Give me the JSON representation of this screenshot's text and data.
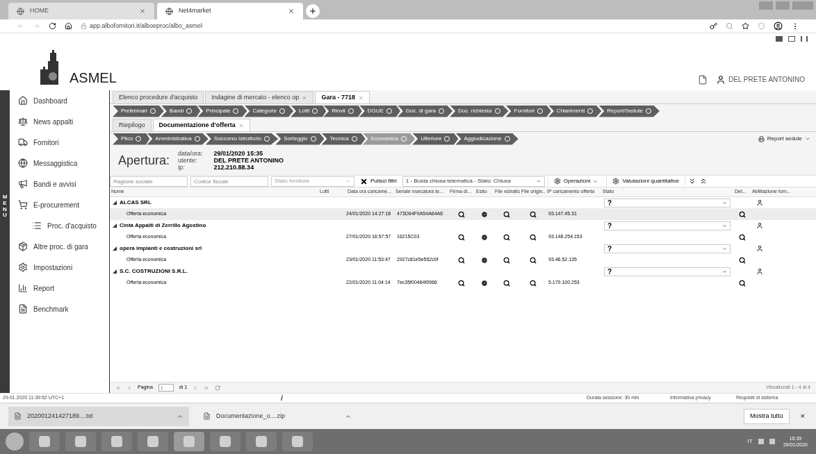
{
  "browser": {
    "tabs": [
      {
        "label": "HOME",
        "selected": false
      },
      {
        "label": "Net4market",
        "selected": true
      }
    ],
    "url": "app.albofornitori.it/alboeproc/albo_asmel"
  },
  "header": {
    "logo": "ASMEL",
    "user": "DEL PRETE ANTONINO"
  },
  "menu_strip": "MENU",
  "sidebar": {
    "items": [
      {
        "label": "Dashboard"
      },
      {
        "label": "News appalti"
      },
      {
        "label": "Fornitori"
      },
      {
        "label": "Messaggistica"
      },
      {
        "label": "Bandi e avvisi"
      },
      {
        "label": "E-procurement",
        "children": [
          {
            "label": "Proc. d'acquisto"
          }
        ]
      },
      {
        "label": "Altre proc. di gara"
      },
      {
        "label": "Impostazioni"
      },
      {
        "label": "Report"
      },
      {
        "label": "Benchmark"
      }
    ]
  },
  "tabs": [
    {
      "label": "Elenco procedure d'acquisto",
      "closable": false,
      "selected": false
    },
    {
      "label": "Indagine di mercato - elenco op",
      "closable": true,
      "selected": false
    },
    {
      "label": "Gara - 7718",
      "closable": true,
      "selected": true
    }
  ],
  "steps_main": [
    {
      "label": "Preliminari"
    },
    {
      "label": "Bandi"
    },
    {
      "label": "Principale"
    },
    {
      "label": "Categorie"
    },
    {
      "label": "Lotti"
    },
    {
      "label": "Rinvii"
    },
    {
      "label": "DGUE"
    },
    {
      "label": "Doc. di gara"
    },
    {
      "label": "Doc. richiesta"
    },
    {
      "label": "Fornitori"
    },
    {
      "label": "Chiarimenti"
    },
    {
      "label": "Report/Sedute"
    }
  ],
  "subtabs": [
    {
      "label": "Riepilogo",
      "closable": false,
      "selected": false
    },
    {
      "label": "Documentazione d'offerta",
      "closable": true,
      "selected": true
    }
  ],
  "steps_offer": [
    {
      "label": "Plico",
      "selected": false
    },
    {
      "label": "Amministrativa",
      "selected": false
    },
    {
      "label": "Soccorso istruttorio",
      "selected": false
    },
    {
      "label": "Sorteggio",
      "selected": false
    },
    {
      "label": "Tecnica",
      "selected": false
    },
    {
      "label": "Economica",
      "selected": true
    },
    {
      "label": "Ulteriore",
      "selected": false
    },
    {
      "label": "Aggiudicazione",
      "selected": false
    }
  ],
  "report_button": "Report sedute",
  "opening": {
    "title": "Apertura:",
    "fields": [
      {
        "label": "data/ora:",
        "value": "29/01/2020 15:35"
      },
      {
        "label": "utente:",
        "value": "DEL PRETE ANTONINO"
      },
      {
        "label": "ip:",
        "value": "212.210.88.34"
      }
    ]
  },
  "filters": {
    "ragione_placeholder": "Ragione sociale",
    "codice_placeholder": "Codice fiscale",
    "stato_placeholder": "Stato fornitore",
    "clear": "Pulisci filtri",
    "busta": "1 - Busta chiusa telematica - Stato: Chiusa",
    "operations": "Operazioni",
    "valuations": "Valutazioni quantitative"
  },
  "table": {
    "columns": [
      "Nome",
      "Lotti",
      "Data ora caricame...",
      "Seriale marcatura te...",
      "Firma di...",
      "Esito",
      "File estratto",
      "File origin...",
      "IP caricamento offerta",
      "Stato",
      "Det...",
      "Abilitazione forn..."
    ],
    "groups": [
      {
        "name": "ALCAS SRL",
        "expanded": true,
        "stato": "?",
        "offers": [
          {
            "nome": "Offerta economica",
            "data": "24/01/2020 14:27:18",
            "seriale": "473D64F9A54A64AE",
            "ip": "93.147.45.31",
            "selected": true
          }
        ]
      },
      {
        "name": "Cinta Appalti di Zerrillo Agostino",
        "expanded": true,
        "stato": "?",
        "offers": [
          {
            "nome": "Offerta economica",
            "data": "27/01/2020 16:57:57",
            "seriale": "16215C03",
            "ip": "93.148.254.153",
            "selected": false
          }
        ]
      },
      {
        "name": "opera impianti e costruzioni srl",
        "expanded": true,
        "stato": "?",
        "offers": [
          {
            "nome": "Offerta economica",
            "data": "23/01/2020 11:53:47",
            "seriale": "2927c81e5e552c0f",
            "ip": "93.46.52.135",
            "selected": false
          }
        ]
      },
      {
        "name": "S.C. COSTRUZIONI S.R.L.",
        "expanded": true,
        "stato": "?",
        "offers": [
          {
            "nome": "Offerta economica",
            "data": "22/01/2020 11:04:14",
            "seriale": "7ec35f00464f0966",
            "ip": "5.170.100.253",
            "selected": false
          }
        ]
      }
    ]
  },
  "pager": {
    "label": "Pagina",
    "page": "1",
    "of": "di 1",
    "summary": "Visualizzati 1 - 4 di 4"
  },
  "status_bar": {
    "time": "29.01.2020 11:39:52 UTC+1",
    "info": "i",
    "session": "Durata sessione: 30 min",
    "privacy": "Informativa privacy",
    "requirements": "Requisiti di sistema"
  },
  "downloads": {
    "items": [
      "202001241427189....txt",
      "Documentazione_o....zip"
    ],
    "show_all": "Mostra tutto",
    "close": "×"
  },
  "taskbar": {
    "lang": "IT",
    "time": "15:39",
    "date": "29/01/2020"
  }
}
